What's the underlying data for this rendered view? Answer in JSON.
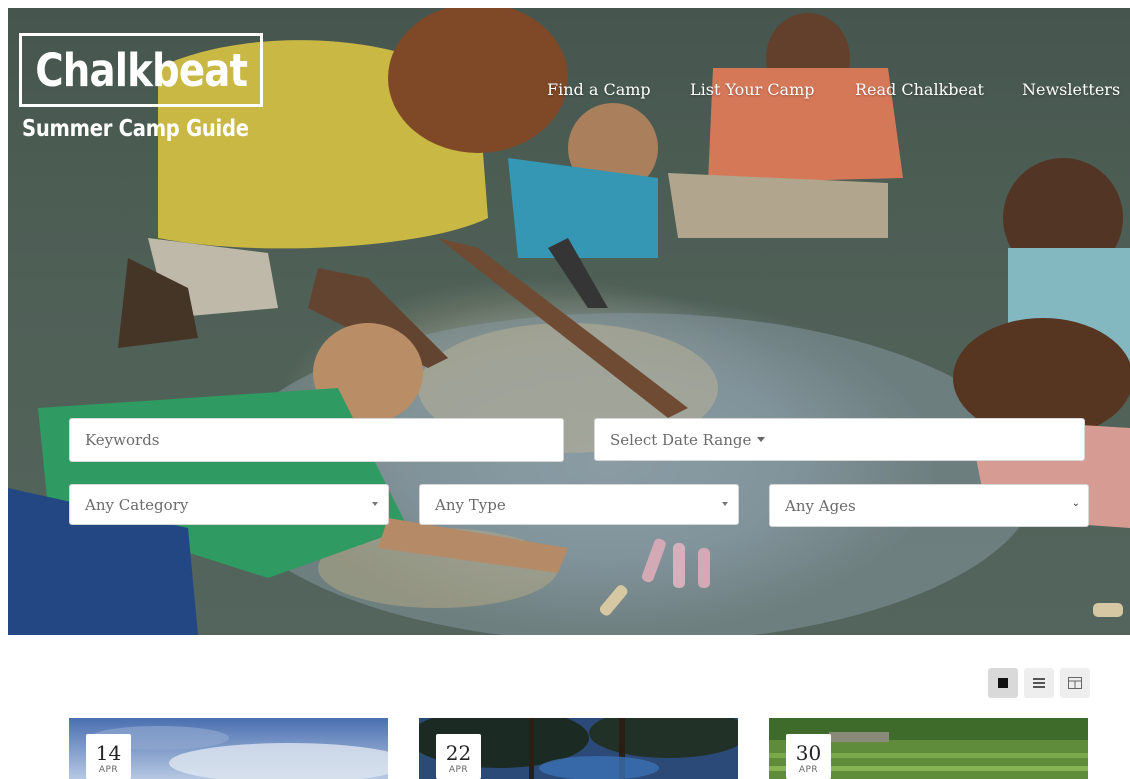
{
  "brand": {
    "logo_text": "Chalkbeat",
    "subtitle": "Summer Camp Guide"
  },
  "nav": {
    "items": [
      {
        "label": "Find a Camp"
      },
      {
        "label": "List Your Camp"
      },
      {
        "label": "Read Chalkbeat"
      },
      {
        "label": "Newsletters"
      }
    ]
  },
  "search": {
    "keywords_placeholder": "Keywords",
    "date_range_label": "Select Date Range",
    "category_selected": "Any Category",
    "type_selected": "Any Type",
    "ages_selected": "Any Ages"
  },
  "view_toggles": [
    "grid-view-icon",
    "list-view-icon",
    "calendar-view-icon"
  ],
  "cards": [
    {
      "day": "14",
      "month": "APR"
    },
    {
      "day": "22",
      "month": "APR"
    },
    {
      "day": "30",
      "month": "APR"
    }
  ],
  "colors": {
    "hero_overlay": "#56695f",
    "white": "#ffffff"
  }
}
